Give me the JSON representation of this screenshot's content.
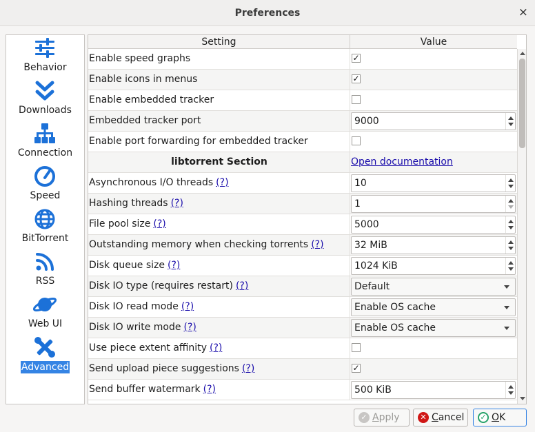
{
  "window": {
    "title": "Preferences",
    "close_glyph": "×"
  },
  "sidebar": {
    "items": [
      {
        "label": "Behavior",
        "icon": "sliders-icon",
        "selected": false
      },
      {
        "label": "Downloads",
        "icon": "double-chevron-down-icon",
        "selected": false
      },
      {
        "label": "Connection",
        "icon": "network-icon",
        "selected": false
      },
      {
        "label": "Speed",
        "icon": "speedometer-icon",
        "selected": false
      },
      {
        "label": "BitTorrent",
        "icon": "globe-icon",
        "selected": false
      },
      {
        "label": "RSS",
        "icon": "rss-icon",
        "selected": false
      },
      {
        "label": "Web UI",
        "icon": "planet-icon",
        "selected": false
      },
      {
        "label": "Advanced",
        "icon": "tools-icon",
        "selected": true
      }
    ]
  },
  "table": {
    "headers": [
      "Setting",
      "Value"
    ],
    "rows": [
      {
        "label": "Enable speed graphs",
        "help": "",
        "type": "checkbox",
        "checked": true
      },
      {
        "label": "Enable icons in menus",
        "help": "",
        "type": "checkbox",
        "checked": true
      },
      {
        "label": "Enable embedded tracker",
        "help": "",
        "type": "checkbox",
        "checked": false
      },
      {
        "label": "Embedded tracker port",
        "help": "",
        "type": "spin",
        "value": "9000"
      },
      {
        "label": "Enable port forwarding for embedded tracker",
        "help": "",
        "type": "checkbox",
        "checked": false
      },
      {
        "label": "libtorrent Section",
        "help": "",
        "type": "link",
        "value": "Open documentation",
        "section": true
      },
      {
        "label": "Asynchronous I/O threads",
        "help": "(?)",
        "type": "spin",
        "value": "10"
      },
      {
        "label": "Hashing threads",
        "help": "(?)",
        "type": "spin",
        "value": "1",
        "min": true
      },
      {
        "label": "File pool size",
        "help": "(?)",
        "type": "spin",
        "value": "5000"
      },
      {
        "label": "Outstanding memory when checking torrents",
        "help": "(?)",
        "type": "spin",
        "value": "32 MiB"
      },
      {
        "label": "Disk queue size",
        "help": "(?)",
        "type": "spin",
        "value": "1024 KiB"
      },
      {
        "label": "Disk IO type (requires restart)",
        "help": "(?)",
        "type": "combo",
        "value": "Default"
      },
      {
        "label": "Disk IO read mode",
        "help": "(?)",
        "type": "combo",
        "value": "Enable OS cache"
      },
      {
        "label": "Disk IO write mode",
        "help": "(?)",
        "type": "combo",
        "value": "Enable OS cache"
      },
      {
        "label": "Use piece extent affinity",
        "help": "(?)",
        "type": "checkbox",
        "checked": false
      },
      {
        "label": "Send upload piece suggestions",
        "help": "(?)",
        "type": "checkbox",
        "checked": true
      },
      {
        "label": "Send buffer watermark",
        "help": "(?)",
        "type": "spin",
        "value": "500 KiB"
      }
    ]
  },
  "buttons": {
    "apply": {
      "mnemonic": "A",
      "rest": "pply"
    },
    "cancel": {
      "mnemonic": "C",
      "rest": "ancel"
    },
    "ok": {
      "mnemonic": "O",
      "rest": "K"
    }
  },
  "colors": {
    "accent": "#3584e4",
    "link": "#1a0dab",
    "cancel": "#d01716",
    "ok": "#26a269"
  }
}
